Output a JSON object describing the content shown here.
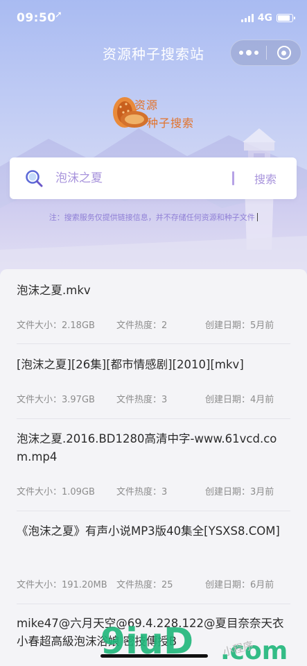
{
  "status_bar": {
    "time": "09:50",
    "network": "4G"
  },
  "nav": {
    "title": "资源种子搜索站"
  },
  "logo": {
    "line1": "资源",
    "line2": "种子搜索"
  },
  "search": {
    "placeholder": "泡沫之夏",
    "value": "",
    "button_label": "搜索"
  },
  "notice": "注：搜索服务仅提供链接信息，并不存储任何资源和种子文件",
  "results": [
    {
      "title": "泡沫之夏.mkv",
      "size": "文件大小：2.18GB",
      "hot": "文件热度：2",
      "date": "创建日期：5月前"
    },
    {
      "title": "[泡沫之夏][26集][都市情感剧][2010][mkv]",
      "size": "文件大小：3.97GB",
      "hot": "文件热度：3",
      "date": "创建日期：4月前"
    },
    {
      "title": "泡沫之夏.2016.BD1280高清中字-www.61vcd.com.mp4",
      "size": "文件大小：1.09GB",
      "hot": "文件热度：3",
      "date": "创建日期：3月前"
    },
    {
      "title": "《泡沫之夏》有声小说MP3版40集全[YSXS8.COM]",
      "size": "文件大小：191.20MB",
      "hot": "文件热度：25",
      "date": "创建日期：6月前"
    },
    {
      "title": "mike47@六月天空@69.4.228.122@夏目奈奈天衣小春超高級泡沫浴娘 密技傳授B"
    }
  ],
  "watermark": {
    "text_main": "9iuD",
    "text_tail": ".com",
    "handwriting": "小程序"
  },
  "colors": {
    "accent": "#a894dc",
    "notice": "#8f7fd6",
    "logo_orange": "#e2732a",
    "watermark_green": "#1fb67a"
  }
}
